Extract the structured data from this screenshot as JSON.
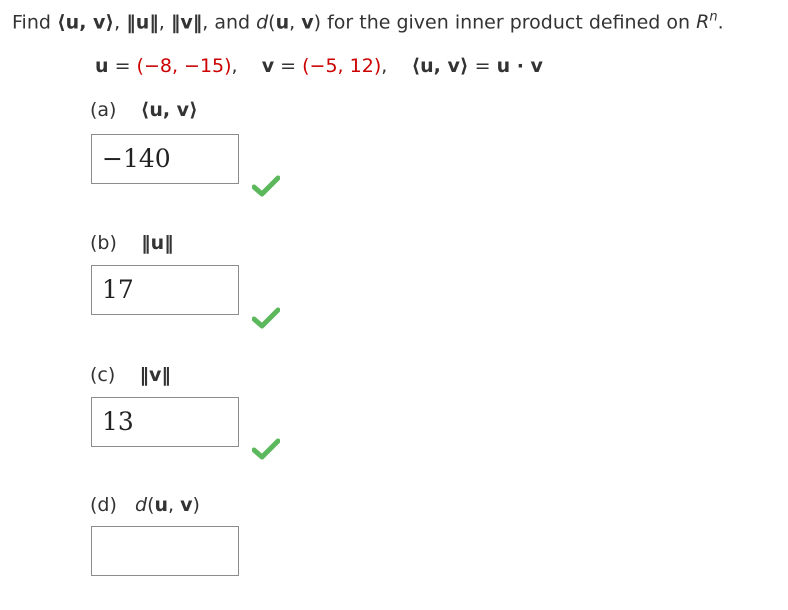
{
  "question": {
    "find_word": "Find",
    "uv_inner": "(u, v)",
    "norm_u": "||u||",
    "norm_v": "||v||",
    "and_word": "and",
    "d_uv": "d(u, v)",
    "rest": "for the given inner product defined on",
    "space_base": "R",
    "space_exp": "n",
    "space_end": "."
  },
  "given": {
    "u_name": "u",
    "u_value": "(−8, −15)",
    "v_name": "v",
    "v_value": "(−5, 12)",
    "inner_def_lhs": "(u, v)",
    "inner_def_rhs": "u · v"
  },
  "parts": [
    {
      "label": "(a)",
      "expr": "(u, v)",
      "answer": "−140",
      "status": "correct"
    },
    {
      "label": "(b)",
      "expr": "||u||",
      "answer": "17",
      "status": "correct"
    },
    {
      "label": "(c)",
      "expr": "||v||",
      "answer": "13",
      "status": "correct"
    },
    {
      "label": "(d)",
      "expr": "d(u, v)",
      "answer": "",
      "status": "unanswered"
    }
  ],
  "colors": {
    "value_red": "#cc0000",
    "check_green": "#5cb85c"
  }
}
